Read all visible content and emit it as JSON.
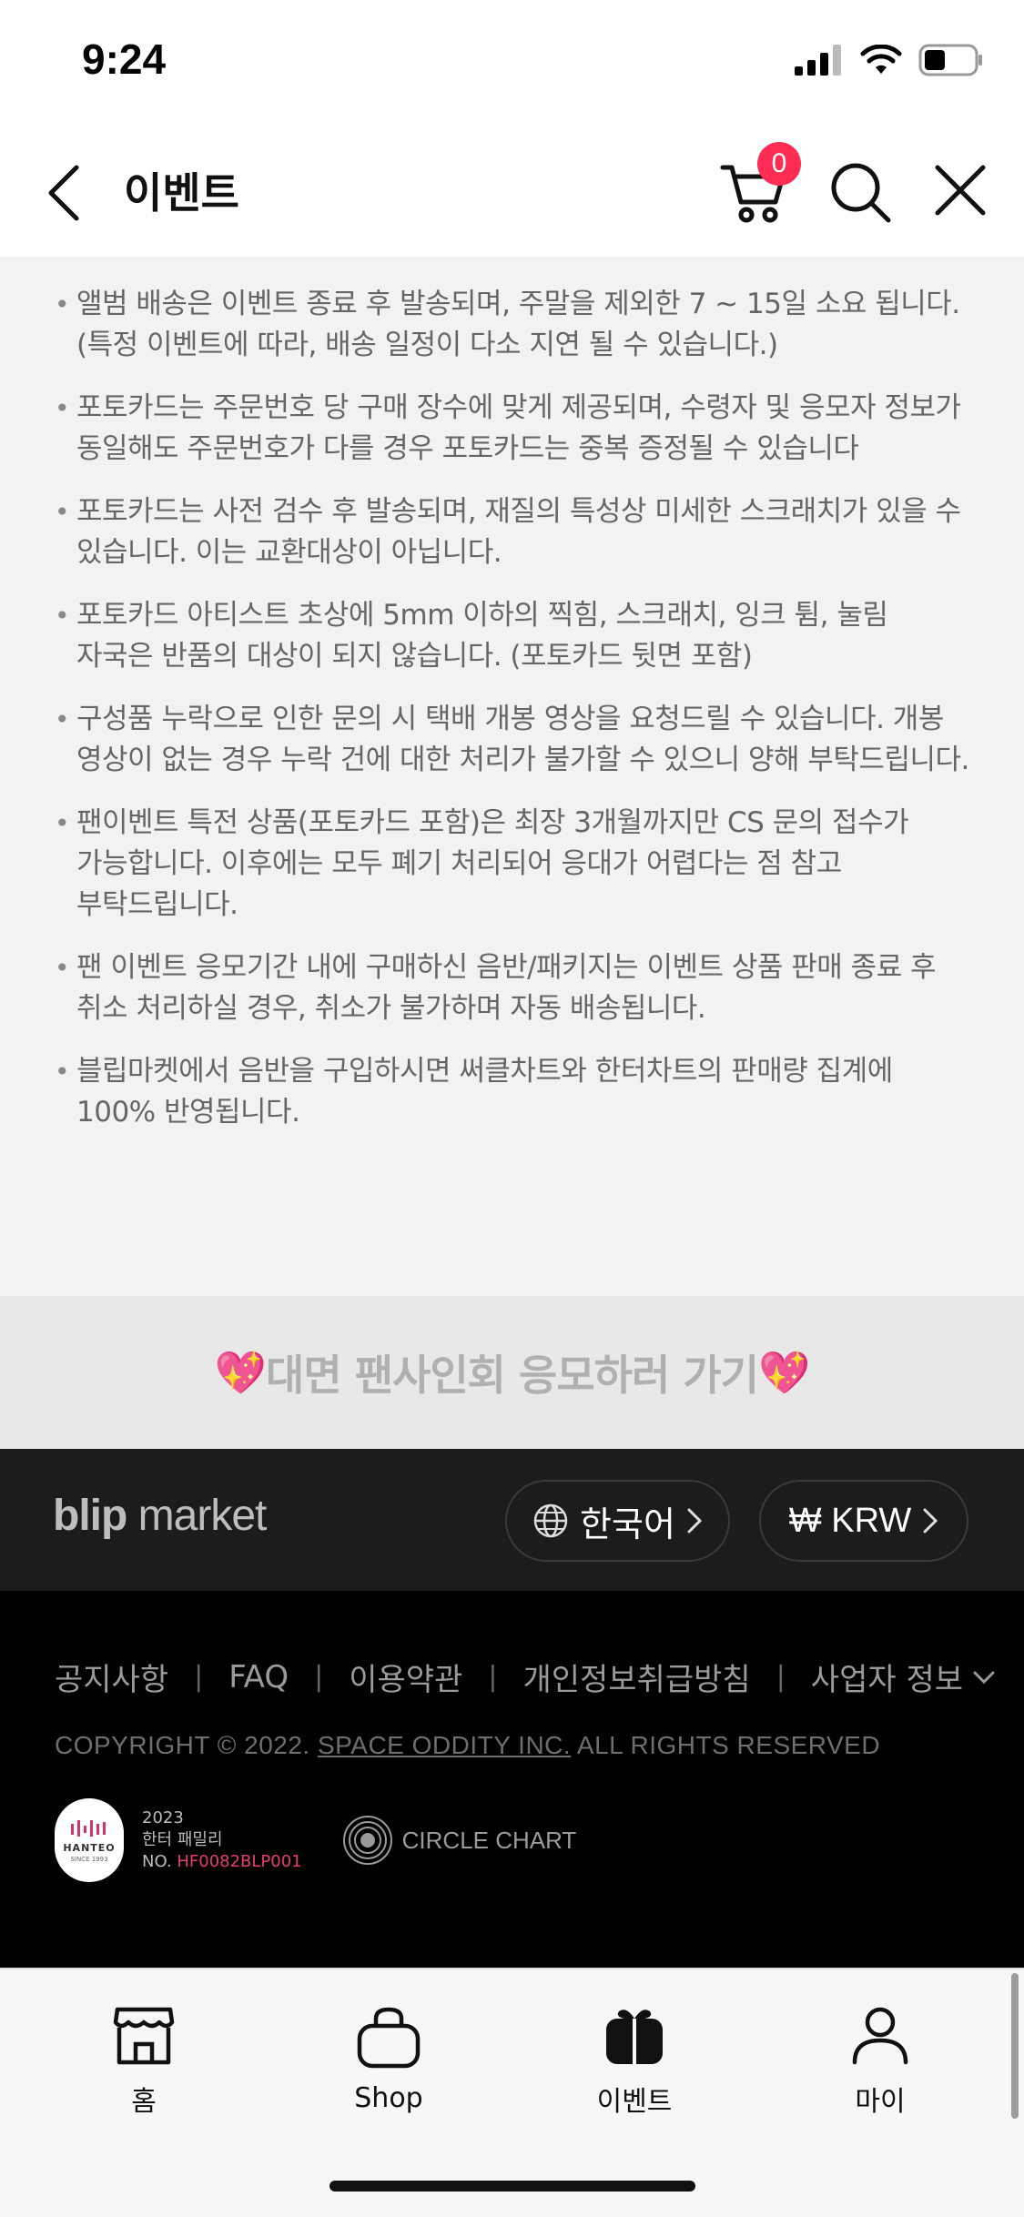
{
  "status_bar": {
    "time": "9:24"
  },
  "header": {
    "title": "이벤트",
    "cart_count": "0"
  },
  "notices": [
    "앨범 배송은 이벤트 종료 후 발송되며, 주말을 제외한 7 ~ 15일 소요 됩니다. (특정 이벤트에 따라, 배송 일정이 다소 지연 될 수 있습니다.)",
    "포토카드는 주문번호 당 구매 장수에 맞게 제공되며, 수령자 및 응모자 정보가 동일해도 주문번호가 다를 경우 포토카드는 중복 증정될 수 있습니다",
    "포토카드는 사전 검수 후 발송되며, 재질의 특성상 미세한 스크래치가 있을 수 있습니다. 이는 교환대상이 아닙니다.",
    "포토카드 아티스트 초상에 5mm 이하의 찍힘, 스크래치, 잉크 튐, 눌림 자국은 반품의 대상이 되지 않습니다. (포토카드 뒷면 포함)",
    "구성품 누락으로 인한 문의 시 택배 개봉 영상을 요청드릴 수 있습니다. 개봉 영상이 없는 경우 누락 건에 대한 처리가 불가할 수 있으니 양해 부탁드립니다.",
    "팬이벤트 특전 상품(포토카드 포함)은 최장 3개월까지만 CS 문의 접수가 가능합니다. 이후에는 모두 폐기 처리되어 응대가 어렵다는 점 참고 부탁드립니다.",
    "팬 이벤트 응모기간 내에 구매하신 음반/패키지는 이벤트 상품 판매 종료 후 취소 처리하실 경우, 취소가 불가하며 자동 배송됩니다.",
    "블립마켓에서 음반을 구입하시면 써클차트와 한터차트의 판매량 집계에 100% 반영됩니다."
  ],
  "cta": {
    "label": "대면 팬사인회 응모하러 가기",
    "emoji_left": "💖",
    "emoji_right": "💖"
  },
  "footer": {
    "logo_bold": "blip",
    "logo_rest": " market",
    "language": "한국어",
    "currency": "₩ KRW",
    "links": [
      "공지사항",
      "FAQ",
      "이용약관",
      "개인정보취급방침",
      "사업자 정보"
    ],
    "copyright_prefix": "COPYRIGHT © 2022. ",
    "copyright_company": "SPACE ODDITY INC.",
    "copyright_suffix": " ALL RIGHTS RESERVED",
    "hanteo_brand": "HANTEO",
    "hanteo_since": "SINCE 1993",
    "hanteo_year": "2023",
    "hanteo_family": "한터 패밀리",
    "hanteo_no_label": "NO. ",
    "hanteo_no": "HF0082BLP001",
    "circle_chart": "CIRCLE CHART"
  },
  "tabbar": {
    "items": [
      {
        "label": "홈",
        "icon": "store-icon"
      },
      {
        "label": "Shop",
        "icon": "shopping-bag-icon"
      },
      {
        "label": "이벤트",
        "icon": "gift-icon"
      },
      {
        "label": "마이",
        "icon": "person-icon"
      }
    ]
  },
  "colors": {
    "badge": "#ff2c55",
    "footer_dark": "#1c1c1c",
    "hanteo_number": "#e43e6e"
  }
}
